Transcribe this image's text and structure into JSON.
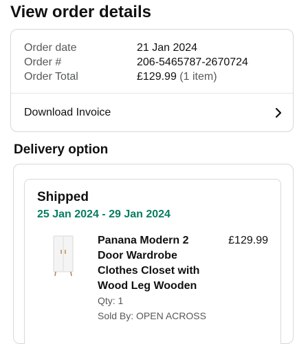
{
  "page": {
    "title": "View order details"
  },
  "summary": {
    "rows": [
      {
        "label": "Order date",
        "value": "21 Jan 2024"
      },
      {
        "label": "Order #",
        "value": "206-5465787-2670724"
      },
      {
        "label": "Order Total",
        "value": "£129.99",
        "extra": "(1 item)"
      }
    ],
    "invoice_label": "Download Invoice",
    "invoice_icon": "chevron-right-icon"
  },
  "delivery": {
    "section_title": "Delivery option",
    "status": "Shipped",
    "dates": "25 Jan 2024 - 29 Jan 2024",
    "item": {
      "name": "Panana Modern 2 Door Wardrobe Clothes Closet with Wood Leg Wooden",
      "price": "£129.99",
      "qty": "Qty: 1",
      "seller": "Sold By: OPEN ACROSS",
      "image": "white-wardrobe-image"
    }
  },
  "colors": {
    "text": "#0f1111",
    "secondary": "#565959",
    "delivery_green": "#067d62",
    "border": "#d5d9d9"
  }
}
